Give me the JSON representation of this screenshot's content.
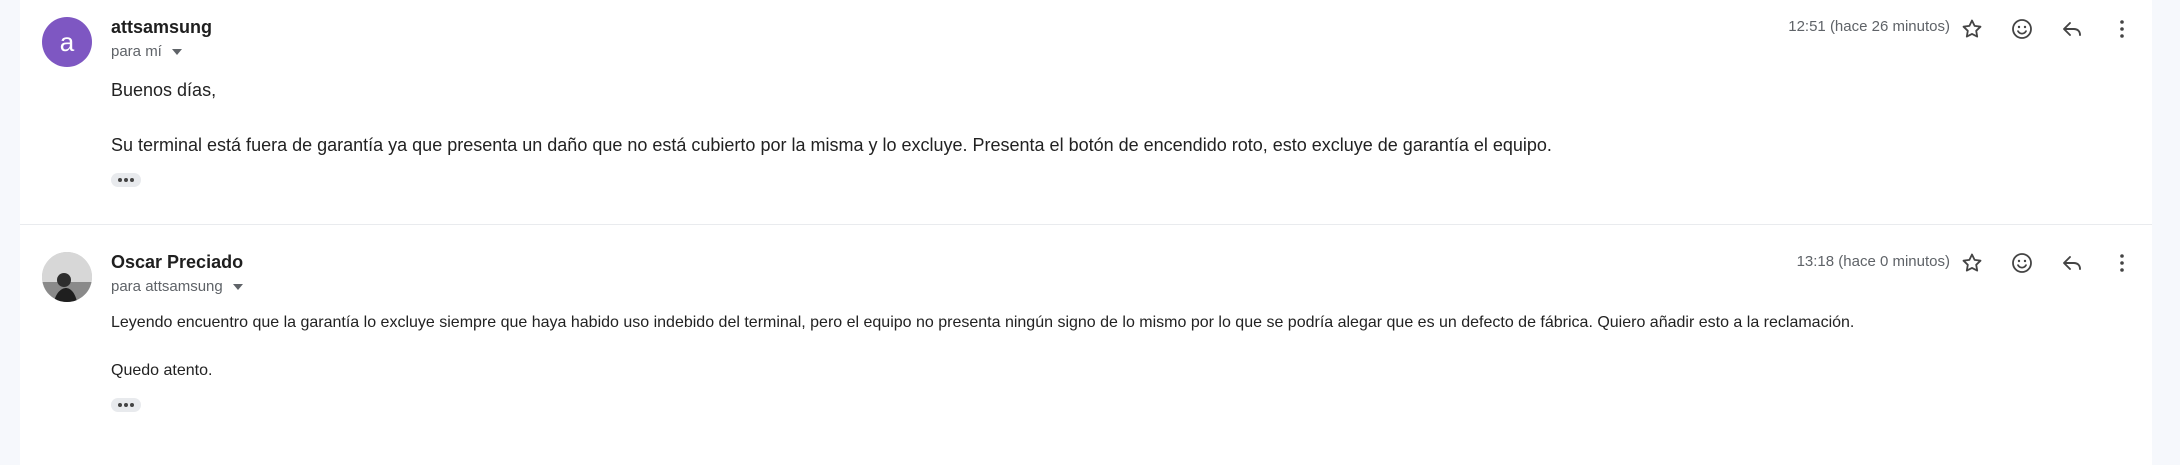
{
  "messages": [
    {
      "sender": "attsamsung",
      "avatar_letter": "a",
      "recipient": "para mí",
      "time": "12:51 (hace 26 minutos)",
      "greeting": "Buenos días,",
      "body": "Su terminal está fuera de garantía ya que presenta un daño que no está cubierto por la misma y lo excluye. Presenta el botón de encendido roto, esto excluye de garantía el equipo."
    },
    {
      "sender": "Oscar Preciado",
      "recipient": "para attsamsung",
      "time": "13:18 (hace 0 minutos)",
      "body": "Leyendo encuentro que la garantía lo excluye siempre que haya habido uso indebido del terminal, pero el equipo no presenta ningún signo de lo mismo por lo que se podría alegar que es un defecto de fábrica. Quiero añadir esto a la reclamación.",
      "closing": "Quedo atento."
    }
  ],
  "icons": {
    "star": "star-icon",
    "emoji": "emoji-icon",
    "reply": "reply-icon",
    "more": "more-vert-icon"
  },
  "colors": {
    "avatar_purple": "#7e57c2",
    "muted_text": "#5f6368",
    "background": "#f6f8fc"
  }
}
